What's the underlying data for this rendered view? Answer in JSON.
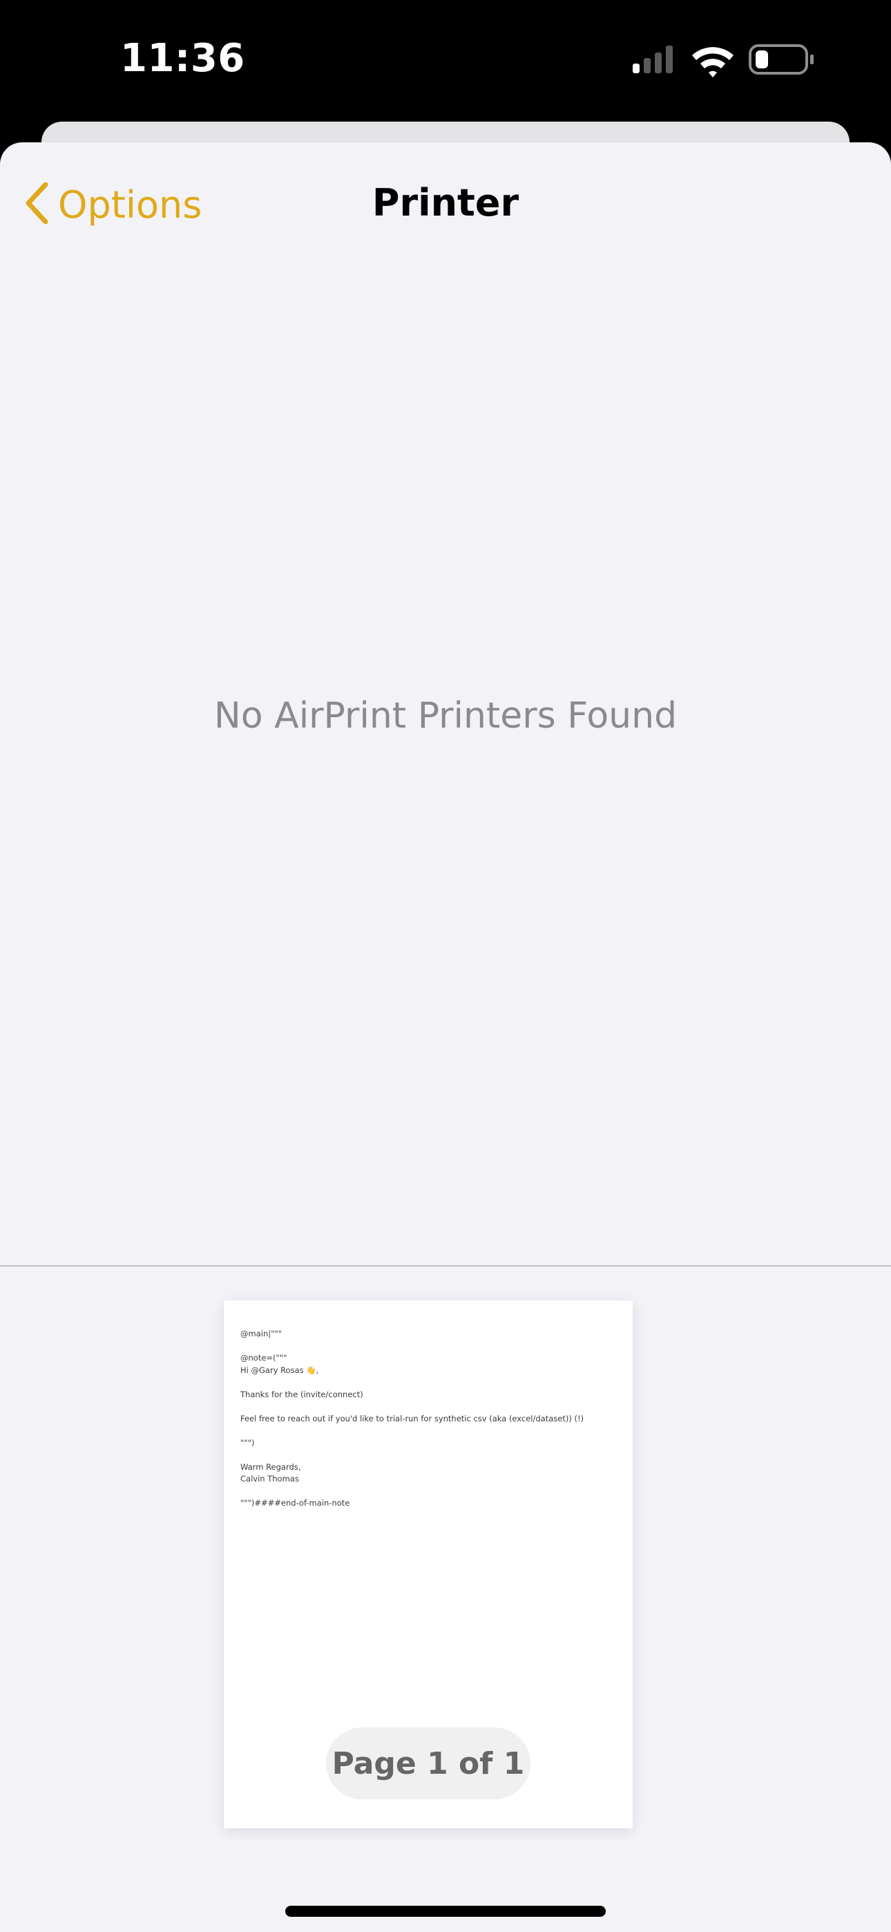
{
  "status_bar": {
    "time": "11:36"
  },
  "nav": {
    "back_label": "Options",
    "title": "Printer"
  },
  "main": {
    "empty_message": "No AirPrint Printers Found"
  },
  "preview": {
    "lines": [
      "@main|\"\"\"",
      "",
      "@note=(\"\"\"",
      "Hi @Gary Rosas 👋,",
      "",
      "Thanks for the (invite/connect)",
      "",
      "Feel free to reach out if you'd like to trial-run for synthetic csv (aka (excel/dataset)) (!)",
      "",
      "\"\"\")",
      "",
      "Warm Regards,",
      "Calvin Thomas",
      "",
      "\"\"\")####end-of-main-note"
    ],
    "page_indicator": "Page 1 of 1"
  },
  "colors": {
    "accent": "#e0a919",
    "sheet_background": "#f2f2f7",
    "secondary_text": "#8a8a8e"
  },
  "icons": [
    "chevron-left-icon",
    "cellular-signal-icon",
    "wifi-icon",
    "battery-icon"
  ]
}
